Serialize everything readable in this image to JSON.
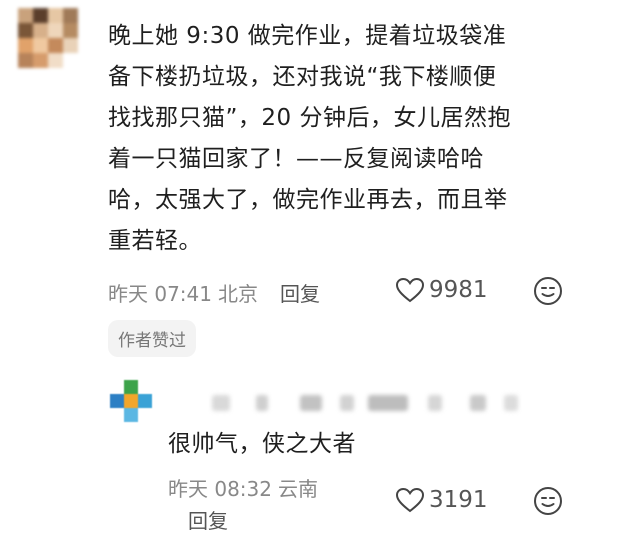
{
  "main_comment": {
    "lines": [
      "晚上她 9:30 做完作业，提着垃圾袋准",
      "备下楼扔垃圾，还对我说“我下楼顺便",
      "找找那只猫”，20 分钟后，女儿居然抱",
      "着一只猫回家了！——反复阅读哈哈",
      "哈，太强大了，做完作业再去，而且举",
      "重若轻。"
    ],
    "time": "昨天 07:41",
    "location": "北京",
    "reply_label": "回复",
    "likes": "9981",
    "author_badge": "作者赞过"
  },
  "reply_comment": {
    "text": "很帅气，侠之大者",
    "time": "昨天 08:32",
    "location": "云南",
    "reply_label": "回复",
    "likes": "3191"
  },
  "icons": {
    "like": "heart-outline-icon",
    "emoji": "emoji-smile-icon"
  },
  "colors": {
    "text": "#1f1f1f",
    "meta": "#888888",
    "badge_bg": "#f3f3f3"
  }
}
